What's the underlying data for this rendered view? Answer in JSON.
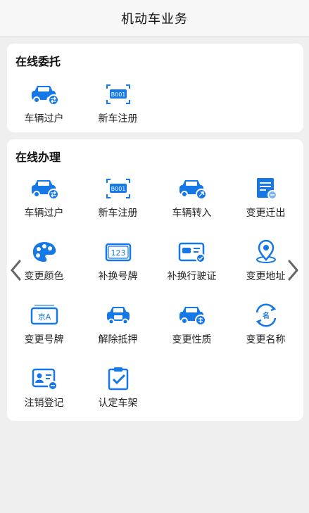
{
  "header": {
    "title": "机动车业务"
  },
  "online_entrust": {
    "title": "在线委托",
    "items": [
      {
        "label": "车辆过户",
        "icon": "car-transfer-icon"
      },
      {
        "label": "新车注册",
        "icon": "plate-scan-icon"
      }
    ]
  },
  "online_handle": {
    "title": "在线办理",
    "items": [
      {
        "label": "车辆过户",
        "icon": "car-transfer-icon"
      },
      {
        "label": "新车注册",
        "icon": "plate-scan-icon"
      },
      {
        "label": "车辆转入",
        "icon": "car-transfer-in-icon"
      },
      {
        "label": "变更迁出",
        "icon": "document-change-icon"
      },
      {
        "label": "变更颜色",
        "icon": "palette-icon"
      },
      {
        "label": "补换号牌",
        "icon": "license-plate-icon"
      },
      {
        "label": "补换行驶证",
        "icon": "driving-license-icon"
      },
      {
        "label": "变更地址",
        "icon": "location-pin-icon"
      },
      {
        "label": "变更号牌",
        "icon": "plate-jing-a-icon"
      },
      {
        "label": "解除抵押",
        "icon": "car-mortgage-release-icon"
      },
      {
        "label": "变更性质",
        "icon": "car-property-icon"
      },
      {
        "label": "变更名称",
        "icon": "name-change-icon"
      },
      {
        "label": "注销登记",
        "icon": "id-card-cancel-icon"
      },
      {
        "label": "认定车架",
        "icon": "clipboard-check-icon"
      }
    ]
  },
  "colors": {
    "accent": "#1677e6",
    "accent_light": "#7fb3f0"
  }
}
